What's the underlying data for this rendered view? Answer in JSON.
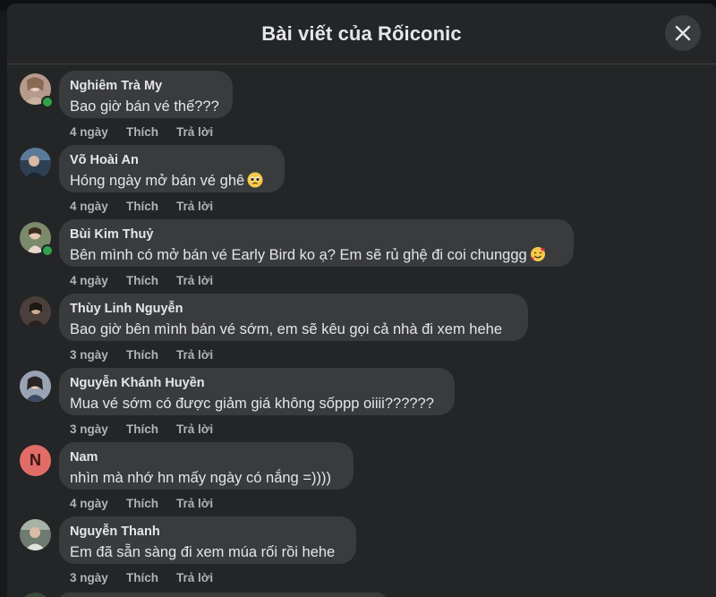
{
  "modal": {
    "title": "Bài viết của Rốiconic",
    "close_label": "Đóng"
  },
  "comments": [
    {
      "author": "Nghiêm Trà My",
      "text": "Bao giờ bán vé thế???",
      "age": "4 ngày",
      "like": "Thích",
      "reply": "Trả lời",
      "online": true
    },
    {
      "author": "Võ Hoài An",
      "text": "Hóng ngày mở bán vé ghê",
      "emoji": "pleading-face",
      "age": "4 ngày",
      "like": "Thích",
      "reply": "Trả lời",
      "online": false
    },
    {
      "author": "Bùi Kim Thuỷ",
      "text": "Bên mình có mở bán vé Early Bird ko ạ? Em sẽ rủ ghệ đi coi chunggg",
      "emoji": "smiling-face-with-hearts",
      "age": "4 ngày",
      "like": "Thích",
      "reply": "Trả lời",
      "online": true
    },
    {
      "author": "Thùy Linh Nguyễn",
      "text": "Bao giờ bên mình bán vé sớm, em sẽ kêu gọi cả nhà đi xem hehe",
      "age": "3 ngày",
      "like": "Thích",
      "reply": "Trả lời",
      "online": false
    },
    {
      "author": "Nguyễn Khánh Huyền",
      "text": "Mua vé sớm có được giảm giá không sốppp oiiii??????",
      "age": "3 ngày",
      "like": "Thích",
      "reply": "Trả lời",
      "online": false
    },
    {
      "author": "Nam",
      "avatar_letter": "N",
      "text": "nhìn mà nhớ hn mấy ngày có nắng =))))",
      "age": "4 ngày",
      "like": "Thích",
      "reply": "Trả lời",
      "online": false
    },
    {
      "author": "Nguyễn Thanh",
      "text": "Em đã sẵn sàng đi xem múa rối rồi hehe",
      "age": "3 ngày",
      "like": "Thích",
      "reply": "Trả lời",
      "online": false
    }
  ],
  "colors": {
    "background": "#242526",
    "bubble": "#3a3b3c",
    "text": "#e4e6eb",
    "muted": "#b0b3b8",
    "online": "#31a24c",
    "letter_avatar": "#e26d68"
  }
}
